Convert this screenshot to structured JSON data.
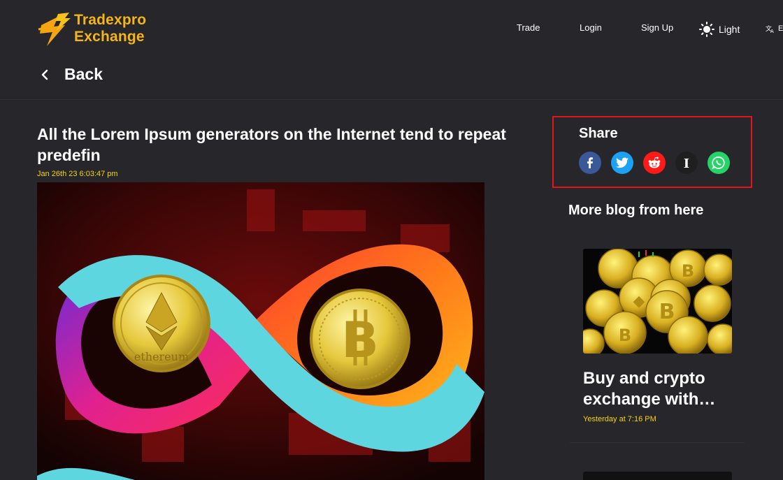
{
  "header": {
    "logo_line1": "Tradexpro",
    "logo_line2": "Exchange",
    "nav": {
      "trade": "Trade",
      "login": "Login",
      "signup": "Sign Up"
    },
    "theme_label": "Light",
    "lang_label": "E"
  },
  "back_label": "Back",
  "article": {
    "title": "All the Lorem Ipsum generators on the Internet tend to repeat predefin",
    "date": "Jan 26th 23 6:03:47 pm",
    "coin_left_text": "ethereum"
  },
  "share": {
    "title": "Share",
    "icons": [
      {
        "name": "facebook-icon",
        "color": "#3b5998",
        "glyph": "f"
      },
      {
        "name": "twitter-icon",
        "color": "#1da1f2",
        "glyph": ""
      },
      {
        "name": "reddit-icon",
        "color": "#ff4500",
        "glyph": ""
      },
      {
        "name": "instapaper-icon",
        "color": "#1f1f1f",
        "glyph": "I"
      },
      {
        "name": "whatsapp-icon",
        "color": "#25d366",
        "glyph": ""
      }
    ]
  },
  "more_blog": {
    "title": "More blog from here",
    "posts": [
      {
        "title": "Buy and crypto exchange with…",
        "date": "Yesterday at 7:16 PM"
      }
    ]
  },
  "colors": {
    "accent": "#f5b417",
    "date": "#f5d312",
    "highlight_border": "#e3141b",
    "bg": "#27272b"
  }
}
